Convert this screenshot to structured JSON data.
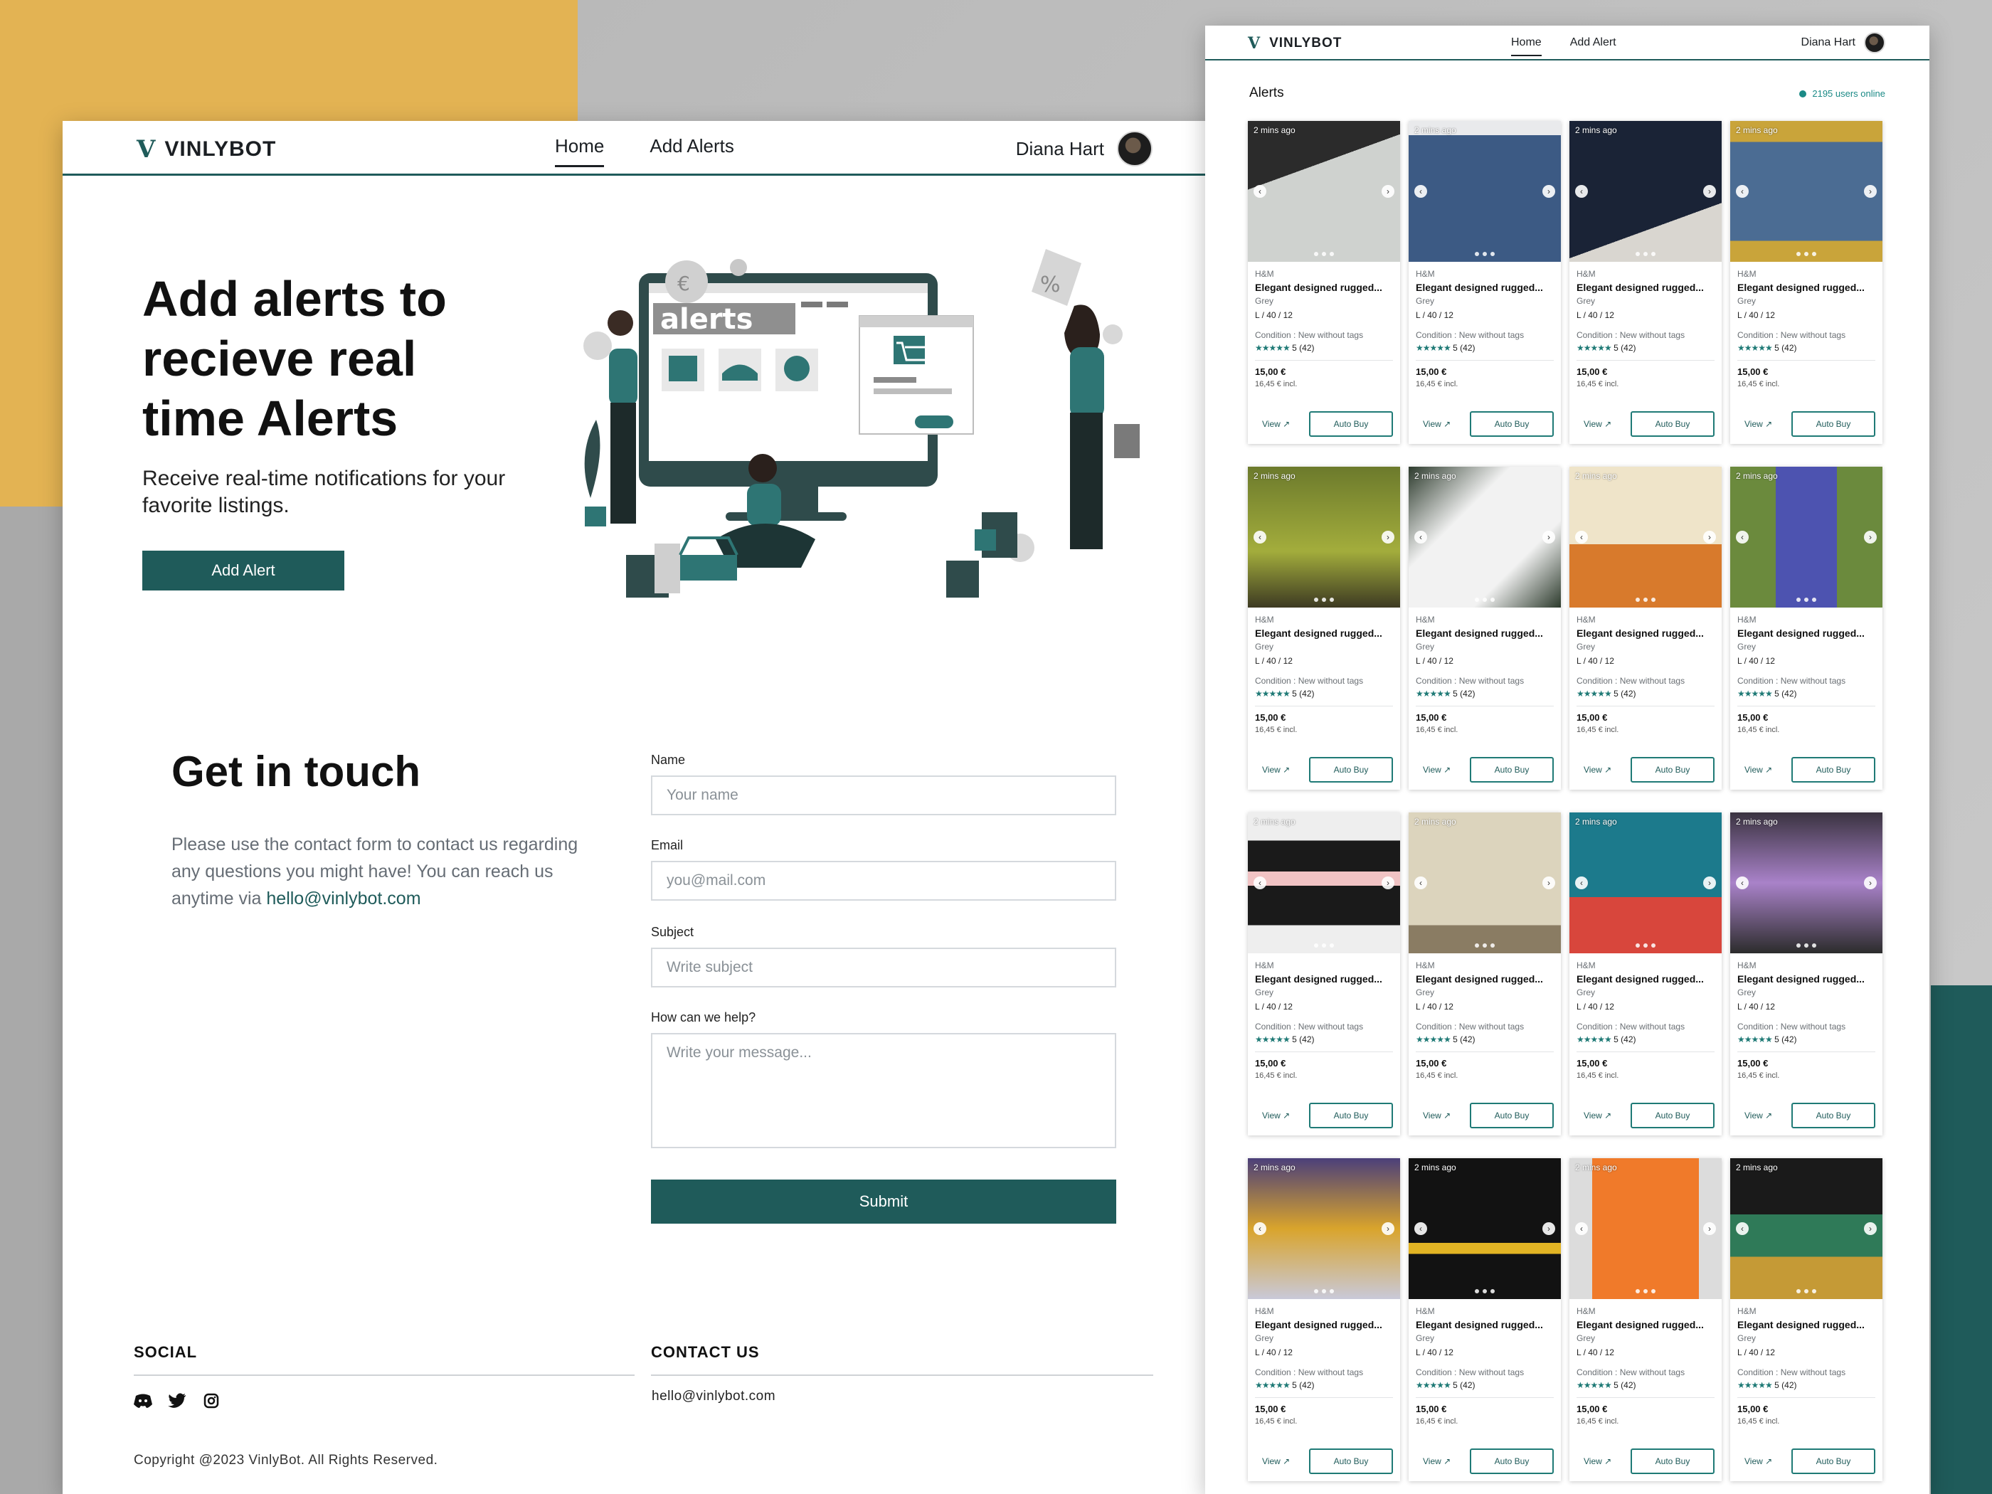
{
  "left": {
    "brand": "VINLYBOT",
    "nav": {
      "home": "Home",
      "add_alerts": "Add Alerts"
    },
    "user_name": "Diana Hart",
    "hero": {
      "title": "Add alerts to recieve real time Alerts",
      "subtitle": "Receive real-time notifications for your favorite listings.",
      "cta": "Add Alert",
      "illustration_text": "alerts"
    },
    "contact": {
      "title": "Get in touch",
      "text": "Please use the contact form to contact us regarding any questions you might have! You can reach us anytime via ",
      "email": "hello@vinlybot.com",
      "name_label": "Name",
      "name_placeholder": "Your name",
      "email_label": "Email",
      "email_placeholder": "you@mail.com",
      "subject_label": "Subject",
      "subject_placeholder": "Write subject",
      "message_label": "How can we help?",
      "message_placeholder": "Write your message...",
      "submit": "Submit"
    },
    "footer": {
      "social_title": "SOCIAL",
      "contact_title": "CONTACT US",
      "contact_email": "hello@vinlybot.com",
      "copyright": "Copyright @2023 VinlyBot. All Rights Reserved.",
      "icons": [
        "discord-icon",
        "twitter-icon",
        "instagram-icon"
      ]
    }
  },
  "right": {
    "brand": "VINLYBOT",
    "nav": {
      "home": "Home",
      "add_alert": "Add Alert"
    },
    "user_name": "Diana Hart",
    "alerts_title": "Alerts",
    "users_online": "2195 users online",
    "card": {
      "time": "2 mins ago",
      "brand": "H&M",
      "title": "Elegant designed rugged...",
      "color": "Grey",
      "size": "L / 40 / 12",
      "condition": "Condition : New without tags",
      "stars": "★★★★★",
      "rating": "5 (42)",
      "price": "15,00 €",
      "price_incl": "16,45 € incl.",
      "view": "View ↗",
      "auto_buy": "Auto Buy"
    },
    "items": [
      "sneakers",
      "ripped-jeans",
      "dark-jeans",
      "blue-jeans",
      "john-deere-cap",
      "airpods",
      "book-judy-moody",
      "water-bottle",
      "striped-sweater",
      "nightstand",
      "book-the-foot-book",
      "toy-cat",
      "sneakers-yellow",
      "football-jersey",
      "phone-case",
      "pendant-necklace"
    ]
  },
  "colors": {
    "primary": "#1f5b5a",
    "accent": "#1b8a86",
    "bg_yellow": "#e3b353"
  }
}
